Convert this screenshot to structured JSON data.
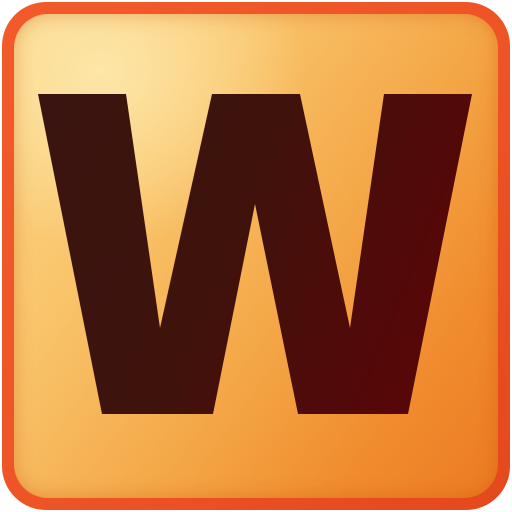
{
  "icon": {
    "letter": "W",
    "colors": {
      "border": "#ee5526",
      "face_light": "#fbd98a",
      "face_dark": "#ec7b23",
      "glyph_light": "#3a1410",
      "glyph_dark": "#560708"
    }
  }
}
